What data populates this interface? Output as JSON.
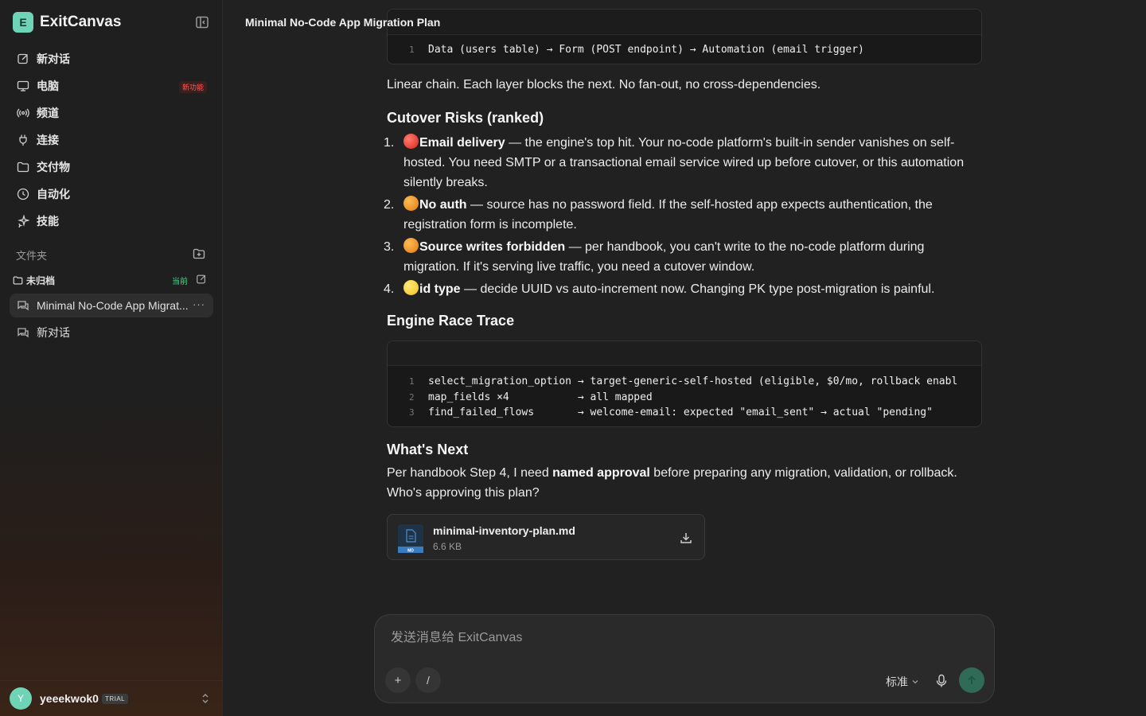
{
  "app": {
    "name": "ExitCanvas",
    "logo_letter": "E"
  },
  "sidebar": {
    "items": [
      {
        "label": "新对话",
        "icon": "edit-icon"
      },
      {
        "label": "电脑",
        "icon": "monitor-icon",
        "badge": "新功能"
      },
      {
        "label": "频道",
        "icon": "broadcast-icon"
      },
      {
        "label": "连接",
        "icon": "plug-icon"
      },
      {
        "label": "交付物",
        "icon": "folder-icon"
      },
      {
        "label": "自动化",
        "icon": "clock-icon"
      },
      {
        "label": "技能",
        "icon": "sparkle-icon"
      }
    ],
    "folders_title": "文件夹",
    "folder": {
      "label": "未归档",
      "current": "当前"
    },
    "chats": [
      {
        "title": "Minimal No-Code App Migrat...",
        "more": "···"
      },
      {
        "title": "新对话"
      }
    ],
    "user": {
      "avatar": "Y",
      "name": "yeeekwok0",
      "plan": "TRIAL"
    }
  },
  "main": {
    "page_title": "Minimal No-Code App Migration Plan",
    "code1": {
      "lines": [
        {
          "n": "1",
          "text": "Data (users table) → Form (POST endpoint) → Automation (email trigger)"
        }
      ]
    },
    "linear_text": "Linear chain. Each layer blocks the next. No fan-out, no cross-dependencies.",
    "risks_heading": "Cutover Risks (ranked)",
    "risks": [
      {
        "num": "1.",
        "color": "red",
        "title": "Email delivery",
        "text": " — the engine's top hit. Your no-code platform's built-in sender vanishes on self-hosted. You need SMTP or a transactional email service wired up before cutover, or this automation silently breaks."
      },
      {
        "num": "2.",
        "color": "orange",
        "title": "No auth",
        "text": " — source has no password field. If the self-hosted app expects authentication, the registration form is incomplete."
      },
      {
        "num": "3.",
        "color": "orange",
        "title": "Source writes forbidden",
        "text": " — per handbook, you can't write to the no-code platform during migration. If it's serving live traffic, you need a cutover window."
      },
      {
        "num": "4.",
        "color": "yellow",
        "title": "id type",
        "text": " — decide UUID vs auto-increment now. Changing PK type post-migration is painful."
      }
    ],
    "trace_heading": "Engine Race Trace",
    "code2": {
      "lines": [
        {
          "n": "1",
          "text": "select_migration_option → target-generic-self-hosted (eligible, $0/mo, rollback enabl"
        },
        {
          "n": "2",
          "text": "map_fields ×4           → all mapped"
        },
        {
          "n": "3",
          "text": "find_failed_flows       → welcome-email: expected \"email_sent\" → actual \"pending\""
        }
      ]
    },
    "next_heading": "What's Next",
    "next_pre": "Per handbook Step 4, I need ",
    "next_bold": "named approval",
    "next_post": " before preparing any migration, validation, or rollback. Who's approving this plan?",
    "file": {
      "name": "minimal-inventory-plan.md",
      "size": "6.6 KB",
      "badge": "MD"
    }
  },
  "composer": {
    "placeholder": "发送消息给 ExitCanvas",
    "plus": "+",
    "slash": "/",
    "mode": "标准"
  },
  "colors": {
    "accent": "#6fd3b5",
    "send": "#2f6b57",
    "badge_red": "#ff5a5a",
    "current_green": "#4fd18f"
  }
}
